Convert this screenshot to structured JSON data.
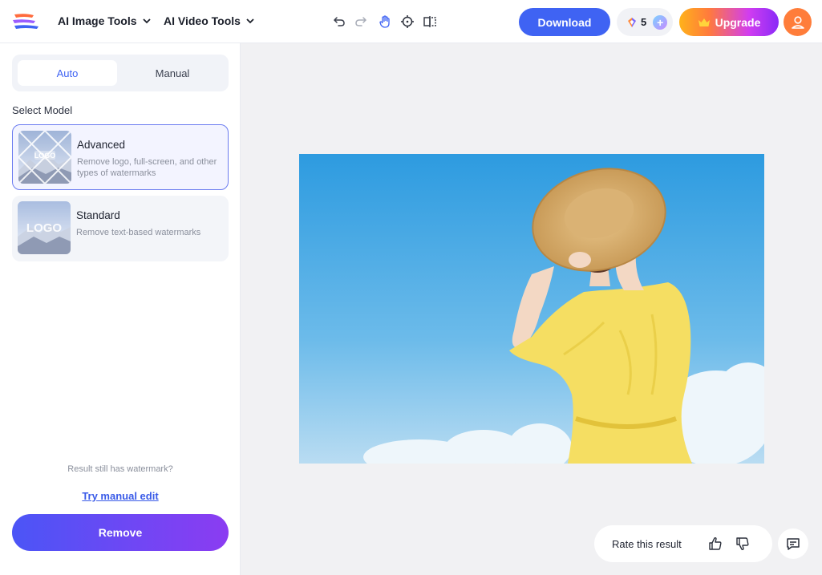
{
  "header": {
    "menus": [
      {
        "label": "AI Image Tools"
      },
      {
        "label": "AI Video Tools"
      }
    ],
    "tools": [
      "undo-icon",
      "redo-icon",
      "hand-icon",
      "crosshair-icon",
      "compare-icon"
    ],
    "download_label": "Download",
    "credits": "5",
    "upgrade_label": "Upgrade"
  },
  "sidebar": {
    "tabs": [
      {
        "label": "Auto",
        "active": true
      },
      {
        "label": "Manual",
        "active": false
      }
    ],
    "section_label": "Select Model",
    "models": [
      {
        "title": "Advanced",
        "description": "Remove logo, full-screen, and other types of watermarks",
        "thumb_text": "LOGO",
        "selected": true
      },
      {
        "title": "Standard",
        "description": "Remove text-based watermarks",
        "thumb_text": "LOGO",
        "selected": false
      }
    ],
    "hint": "Result still has watermark?",
    "manual_link": "Try manual edit",
    "remove_label": "Remove"
  },
  "canvas": {
    "rate_label": "Rate this result"
  },
  "colors": {
    "accent": "#3f63f3",
    "avatar": "#ff7d3a",
    "canvas_bg": "#f1f1f3"
  }
}
